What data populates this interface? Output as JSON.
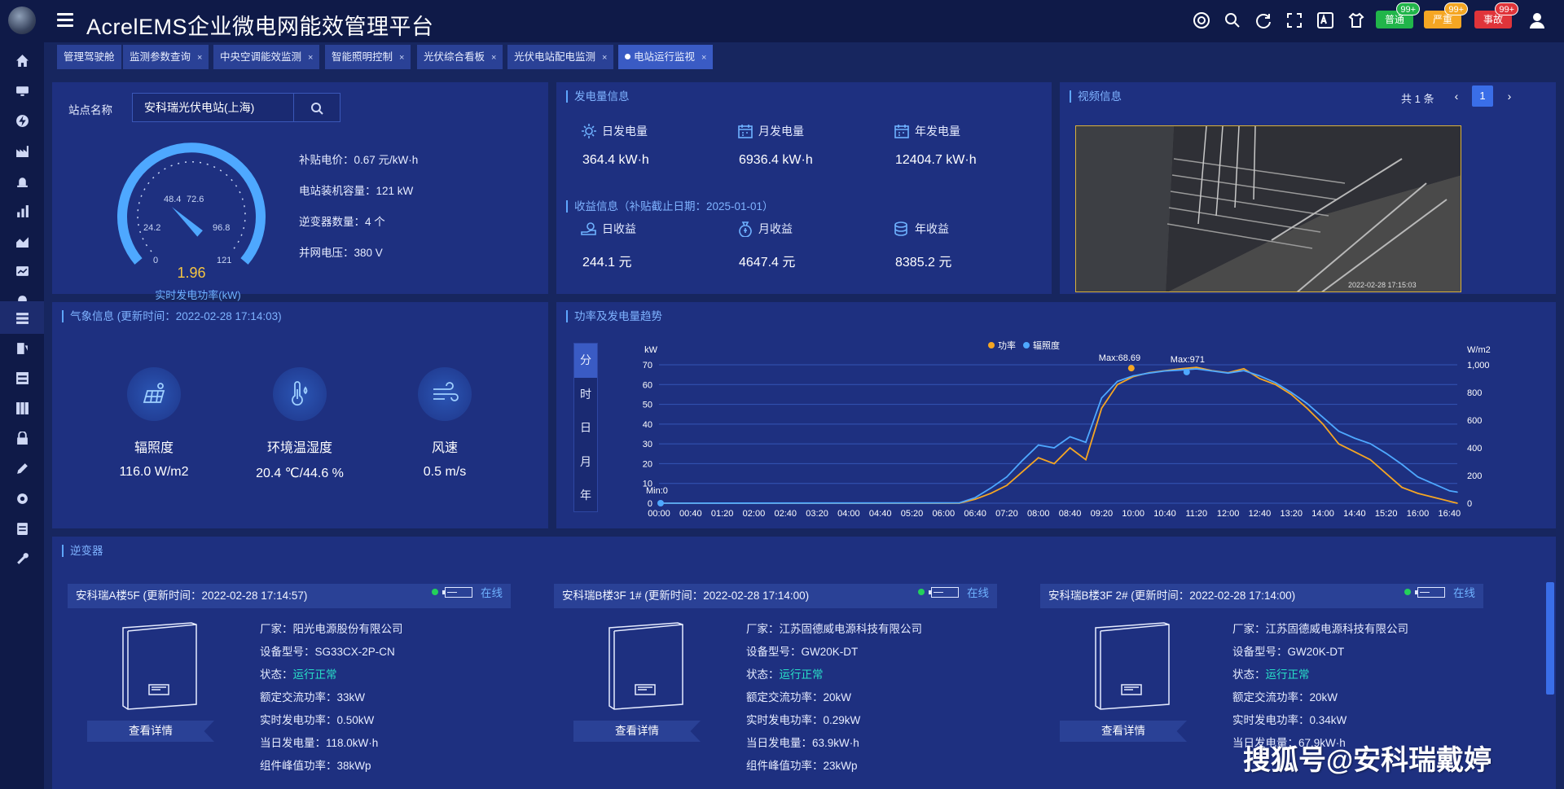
{
  "app": {
    "title": "AcrelEMS企业微电网能效管理平台"
  },
  "header_icons": [
    "help-ring-icon",
    "search-icon",
    "refresh-icon",
    "fullscreen-icon",
    "translate-icon",
    "skin-icon"
  ],
  "alarms": [
    {
      "label": "普通",
      "count": "99+",
      "color": "#21b54a"
    },
    {
      "label": "严重",
      "count": "99+",
      "color": "#f5a623"
    },
    {
      "label": "事故",
      "count": "99+",
      "color": "#e0343a"
    }
  ],
  "tabs": [
    {
      "label": "管理驾驶舱",
      "closable": false
    },
    {
      "label": "监测参数查询",
      "closable": true
    },
    {
      "label": "中央空调能效监测",
      "closable": true
    },
    {
      "label": "智能照明控制",
      "closable": true
    },
    {
      "label": "光伏综合看板",
      "closable": true
    },
    {
      "label": "光伏电站配电监测",
      "closable": true
    },
    {
      "label": "电站运行监视",
      "closable": true,
      "active": true
    }
  ],
  "station": {
    "label": "站点名称",
    "selected": "安科瑞光伏电站(上海)",
    "gauge": {
      "value": "1.96",
      "label": "实时发电功率(kW)",
      "ticks": [
        "0",
        "24.2",
        "48.4",
        "72.6",
        "96.8",
        "121"
      ],
      "max": 121,
      "current": 1.96
    },
    "info": [
      {
        "label": "补贴电价：",
        "value": "0.67 元/kW·h"
      },
      {
        "label": "电站装机容量：",
        "value": "121 kW"
      },
      {
        "label": "逆变器数量：",
        "value": "4 个"
      },
      {
        "label": "并网电压：",
        "value": "380 V"
      }
    ]
  },
  "generation": {
    "title": "发电量信息",
    "items": [
      {
        "label": "日发电量",
        "value": "364.4 kW·h",
        "icon": "sun-icon"
      },
      {
        "label": "月发电量",
        "value": "6936.4 kW·h",
        "icon": "calendar-icon"
      },
      {
        "label": "年发电量",
        "value": "12404.7 kW·h",
        "icon": "calendar-icon"
      }
    ],
    "revenue_title": "收益信息（补贴截止日期：2025-01-01）",
    "revenue": [
      {
        "label": "日收益",
        "value": "244.1 元",
        "icon": "hand-coin-icon"
      },
      {
        "label": "月收益",
        "value": "4647.4 元",
        "icon": "money-bag-icon"
      },
      {
        "label": "年收益",
        "value": "8385.2 元",
        "icon": "coin-stack-icon"
      }
    ]
  },
  "video": {
    "title": "视频信息",
    "total": "共 1 条",
    "page": "1",
    "camera_timestamp": "2022-02-28 17:15:03"
  },
  "weather": {
    "title": "气象信息 (更新时间：2022-02-28 17:14:03)",
    "items": [
      {
        "label": "辐照度",
        "value": "116.0 W/m2",
        "icon": "solar-panel-icon"
      },
      {
        "label": "环境温湿度",
        "value": "20.4 ℃/44.6 %",
        "icon": "thermometer-icon"
      },
      {
        "label": "风速",
        "value": "0.5 m/s",
        "icon": "wind-icon"
      }
    ]
  },
  "trend": {
    "title": "功率及发电量趋势",
    "granularity": [
      "分",
      "时",
      "日",
      "月",
      "年"
    ],
    "active_granularity": "分"
  },
  "chart_data": {
    "type": "line",
    "title": "",
    "ylabel": "kW",
    "y2label": "W/m2",
    "ylim": [
      0,
      70
    ],
    "y2lim": [
      0,
      1000
    ],
    "yticks": [
      "0",
      "10",
      "20",
      "30",
      "40",
      "50",
      "60",
      "70"
    ],
    "y2ticks": [
      "0",
      "200",
      "400",
      "600",
      "800",
      "1,000"
    ],
    "xticks": [
      "00:00",
      "00:40",
      "01:20",
      "02:00",
      "02:40",
      "03:20",
      "04:00",
      "04:40",
      "05:20",
      "06:00",
      "06:40",
      "07:20",
      "08:00",
      "08:40",
      "09:20",
      "10:00",
      "10:40",
      "11:20",
      "12:00",
      "12:40",
      "13:20",
      "14:00",
      "14:40",
      "15:20",
      "16:00",
      "16:40"
    ],
    "legend": "top-center",
    "annotations": {
      "max_power": "Max:68.69",
      "max_irradiance": "Max:971",
      "min": "Min:0"
    },
    "x_minutes": [
      0,
      380,
      400,
      420,
      440,
      460,
      480,
      500,
      520,
      540,
      560,
      580,
      600,
      620,
      640,
      660,
      680,
      700,
      720,
      740,
      760,
      780,
      800,
      820,
      840,
      860,
      880,
      900,
      920,
      940,
      960,
      980,
      1000,
      1010
    ],
    "series": [
      {
        "name": "功率",
        "color": "#f5a623",
        "axis": "left",
        "values": [
          0,
          0,
          2,
          5,
          9,
          16,
          23,
          20,
          28,
          22,
          48,
          60,
          64,
          66,
          67,
          68,
          68.69,
          67,
          66,
          68,
          63,
          60,
          55,
          48,
          40,
          30,
          26,
          22,
          15,
          8,
          5,
          3,
          1,
          0
        ]
      },
      {
        "name": "辐照度",
        "color": "#4ea8ff",
        "axis": "right",
        "values": [
          0,
          2,
          40,
          110,
          190,
          310,
          420,
          400,
          480,
          440,
          760,
          880,
          920,
          940,
          955,
          962,
          971,
          955,
          940,
          958,
          920,
          870,
          800,
          720,
          620,
          520,
          470,
          430,
          360,
          280,
          190,
          140,
          90,
          80
        ]
      }
    ]
  },
  "inverters": {
    "title": "逆变器",
    "cards": [
      {
        "name": "安科瑞A楼5F (更新时间：2022-02-28 17:14:57)",
        "status": "在线",
        "button": "查看详情",
        "fields": [
          {
            "label": "厂家：",
            "value": "阳光电源股份有限公司"
          },
          {
            "label": "设备型号：",
            "value": "SG33CX-2P-CN"
          },
          {
            "label": "状态：",
            "value": "运行正常",
            "ok": true
          },
          {
            "label": "额定交流功率：",
            "value": "33kW"
          },
          {
            "label": "实时发电功率：",
            "value": "0.50kW"
          },
          {
            "label": "当日发电量：",
            "value": "118.0kW·h"
          },
          {
            "label": "组件峰值功率：",
            "value": "38kWp"
          }
        ]
      },
      {
        "name": "安科瑞B楼3F 1# (更新时间：2022-02-28 17:14:00)",
        "status": "在线",
        "button": "查看详情",
        "fields": [
          {
            "label": "厂家：",
            "value": "江苏固德威电源科技有限公司"
          },
          {
            "label": "设备型号：",
            "value": "GW20K-DT"
          },
          {
            "label": "状态：",
            "value": "运行正常",
            "ok": true
          },
          {
            "label": "额定交流功率：",
            "value": "20kW"
          },
          {
            "label": "实时发电功率：",
            "value": "0.29kW"
          },
          {
            "label": "当日发电量：",
            "value": "63.9kW·h"
          },
          {
            "label": "组件峰值功率：",
            "value": "23kWp"
          }
        ]
      },
      {
        "name": "安科瑞B楼3F 2# (更新时间：2022-02-28 17:14:00)",
        "status": "在线",
        "button": "查看详情",
        "fields": [
          {
            "label": "厂家：",
            "value": "江苏固德威电源科技有限公司"
          },
          {
            "label": "设备型号：",
            "value": "GW20K-DT"
          },
          {
            "label": "状态：",
            "value": "运行正常",
            "ok": true
          },
          {
            "label": "额定交流功率：",
            "value": "20kW"
          },
          {
            "label": "实时发电功率：",
            "value": "0.34kW"
          },
          {
            "label": "当日发电量：",
            "value": "67.9kW·h"
          },
          {
            "label": "组件峰值功率：",
            "value": ""
          }
        ]
      }
    ]
  },
  "watermark": "搜狐号@安科瑞戴婷"
}
